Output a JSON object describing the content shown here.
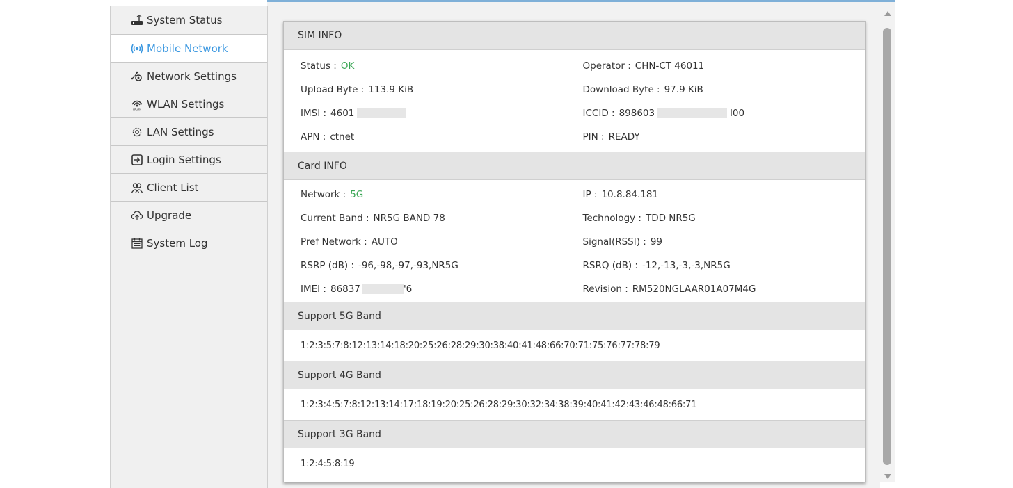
{
  "sidebar": {
    "items": [
      {
        "label": "System Status",
        "icon": "router-icon"
      },
      {
        "label": "Mobile Network",
        "icon": "signal-icon"
      },
      {
        "label": "Network Settings",
        "icon": "network-settings-icon"
      },
      {
        "label": "WLAN Settings",
        "icon": "wlan-icon"
      },
      {
        "label": "LAN Settings",
        "icon": "gear-icon"
      },
      {
        "label": "Login Settings",
        "icon": "login-icon"
      },
      {
        "label": "Client List",
        "icon": "users-icon"
      },
      {
        "label": "Upgrade",
        "icon": "cloud-upload-icon"
      },
      {
        "label": "System Log",
        "icon": "calendar-icon"
      }
    ],
    "active_color": "#3a97e0"
  },
  "sim_info": {
    "title": "SIM INFO",
    "status_label": "Status :",
    "status_value": "OK",
    "operator_label": "Operator :",
    "operator_value": "CHN-CT 46011",
    "upload_label": "Upload Byte :",
    "upload_value": "113.9 KiB",
    "download_label": "Download Byte :",
    "download_value": "97.9 KiB",
    "imsi_label": "IMSI :",
    "imsi_value": "4601",
    "iccid_label": "ICCID :",
    "iccid_prefix": "898603",
    "iccid_suffix": "l00",
    "apn_label": "APN :",
    "apn_value": "ctnet",
    "pin_label": "PIN :",
    "pin_value": "READY"
  },
  "card_info": {
    "title": "Card INFO",
    "network_label": "Network :",
    "network_value": "5G",
    "ip_label": "IP :",
    "ip_value": "10.8.84.181",
    "band_label": "Current Band :",
    "band_value": "NR5G BAND 78",
    "tech_label": "Technology :",
    "tech_value": "TDD NR5G",
    "pref_label": "Pref Network :",
    "pref_value": "AUTO",
    "rssi_label": "Signal(RSSI) :",
    "rssi_value": "99",
    "rsrp_label": "RSRP (dB) :",
    "rsrp_value": "-96,-98,-97,-93,NR5G",
    "rsrq_label": "RSRQ (dB) :",
    "rsrq_value": "-12,-13,-3,-3,NR5G",
    "imei_label": "IMEI :",
    "imei_prefix": "86837",
    "imei_suffix": "'6",
    "revision_label": "Revision :",
    "revision_value": "RM520NGLAAR01A07M4G"
  },
  "bands": {
    "g5_title": "Support 5G Band",
    "g5_value": "1:2:3:5:7:8:12:13:14:18:20:25:26:28:29:30:38:40:41:48:66:70:71:75:76:77:78:79",
    "g4_title": "Support 4G Band",
    "g4_value": "1:2:3:4:5:7:8:12:13:14:17:18:19:20:25:26:28:29:30:32:34:38:39:40:41:42:43:46:48:66:71",
    "g3_title": "Support 3G Band",
    "g3_value": "1:2:4:5:8:19"
  },
  "colors": {
    "ok_green": "#3aa655",
    "header_bg": "#e4e4e4",
    "accent_blue": "#7fb0d8"
  }
}
